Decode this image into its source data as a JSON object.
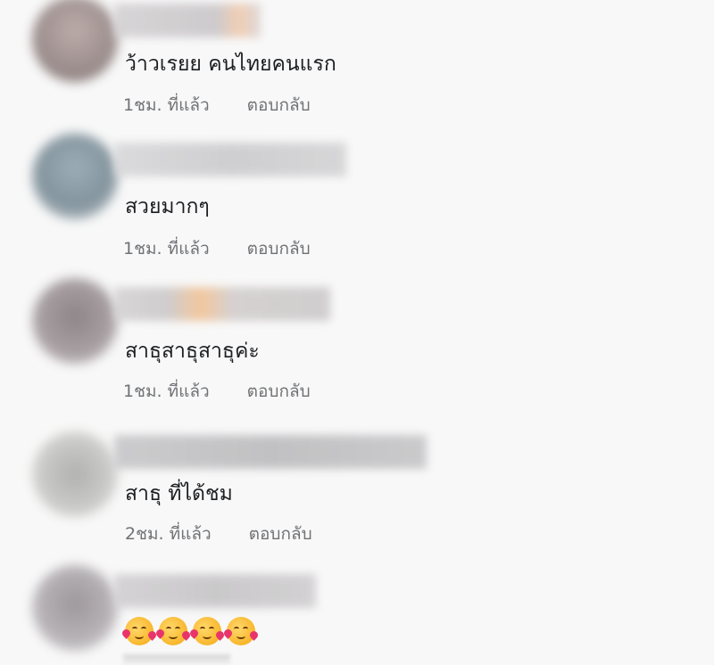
{
  "comments": [
    {
      "text": "ว้าวเรยย คนไทยคนแรก",
      "time": "1ชม. ที่แล้ว",
      "reply_label": "ตอบกลับ",
      "avatar_color": "#8a7a78",
      "name_color": "#c9c6c8",
      "name_accent": "#f0c7a8"
    },
    {
      "text": "สวยมากๆ",
      "time": "1ชม. ที่แล้ว",
      "reply_label": "ตอบกลับ",
      "avatar_color": "#6f8592",
      "name_color": "#cfcfd1",
      "name_accent": ""
    },
    {
      "text": "สาธุสาธุสาธุค่ะ",
      "time": "1ชม. ที่แล้ว",
      "reply_label": "ตอบกลับ",
      "avatar_color": "#7c6f73",
      "name_color": "#cdcacb",
      "name_accent": "#f2bf8e"
    },
    {
      "text": "สาธุ ที่ได้ชม",
      "time": "2ชม. ที่แล้ว",
      "reply_label": "ตอบกลับ",
      "avatar_color": "#a7a8a4",
      "name_color": "#bcbcbe",
      "name_accent": ""
    },
    {
      "emoji_name": "smiling-face-with-hearts-icon",
      "emoji_count": 4,
      "avatar_color": "#8d878c",
      "name_color": "#c6c4c6",
      "name_accent": ""
    }
  ]
}
